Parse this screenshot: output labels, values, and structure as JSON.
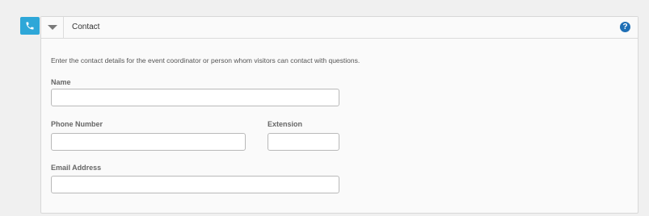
{
  "section": {
    "title": "Contact",
    "help_symbol": "?",
    "intro": "Enter the contact details for the event coordinator or person whom visitors can contact with questions."
  },
  "fields": {
    "name": {
      "label": "Name",
      "value": ""
    },
    "phone": {
      "label": "Phone Number",
      "value": ""
    },
    "extension": {
      "label": "Extension",
      "value": ""
    },
    "email": {
      "label": "Email Address",
      "value": ""
    }
  },
  "icons": {
    "section_icon": "phone-icon",
    "toggle_icon": "caret-down-icon",
    "help_icon": "help-icon"
  },
  "colors": {
    "accent": "#2ea7d8",
    "help": "#1f6fb5"
  }
}
